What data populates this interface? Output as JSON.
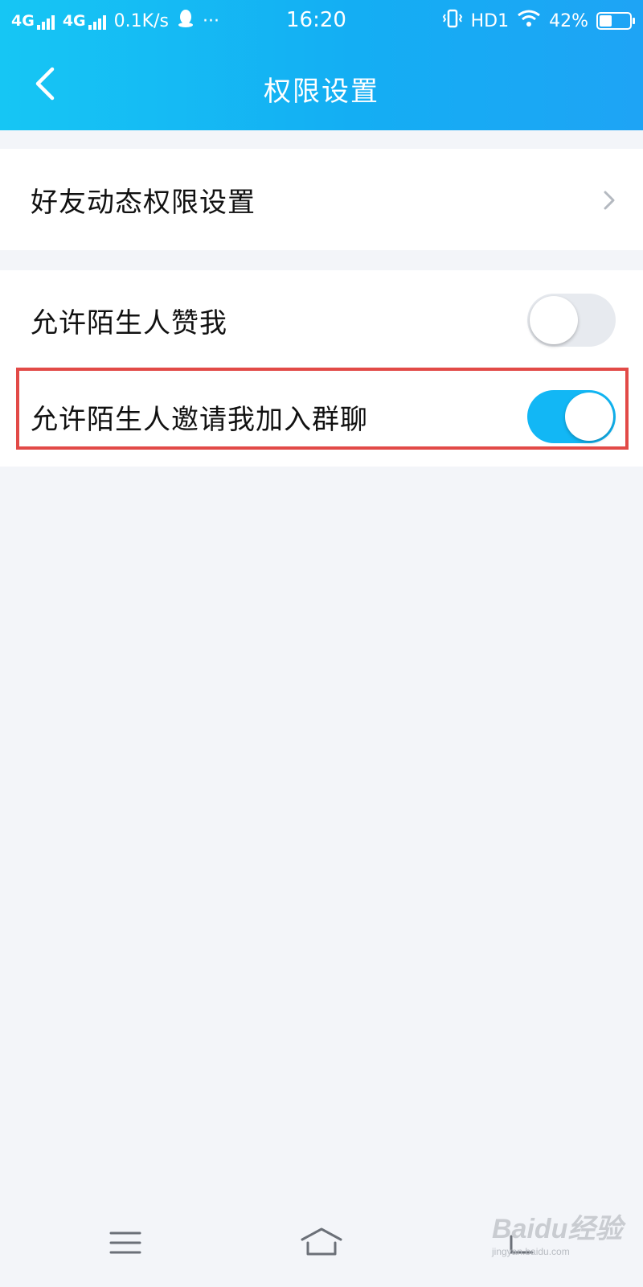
{
  "status_bar": {
    "net1": "4G",
    "net2": "4G",
    "speed": "0.1K/s",
    "dots": "···",
    "time": "16:20",
    "hd": "HD1",
    "battery": "42%",
    "battery_level": 0.42
  },
  "nav": {
    "title": "权限设置"
  },
  "settings": {
    "friend_feed": {
      "label": "好友动态权限设置"
    },
    "stranger_like": {
      "label": "允许陌生人赞我",
      "enabled": false
    },
    "stranger_invite": {
      "label": "允许陌生人邀请我加入群聊",
      "enabled": true
    }
  },
  "colors": {
    "accent": "#12b7f5",
    "highlight": "#e24a47",
    "background": "#f3f5f9"
  },
  "watermark": {
    "brand": "Baidu经验",
    "url": "jingyan.baidu.com"
  }
}
